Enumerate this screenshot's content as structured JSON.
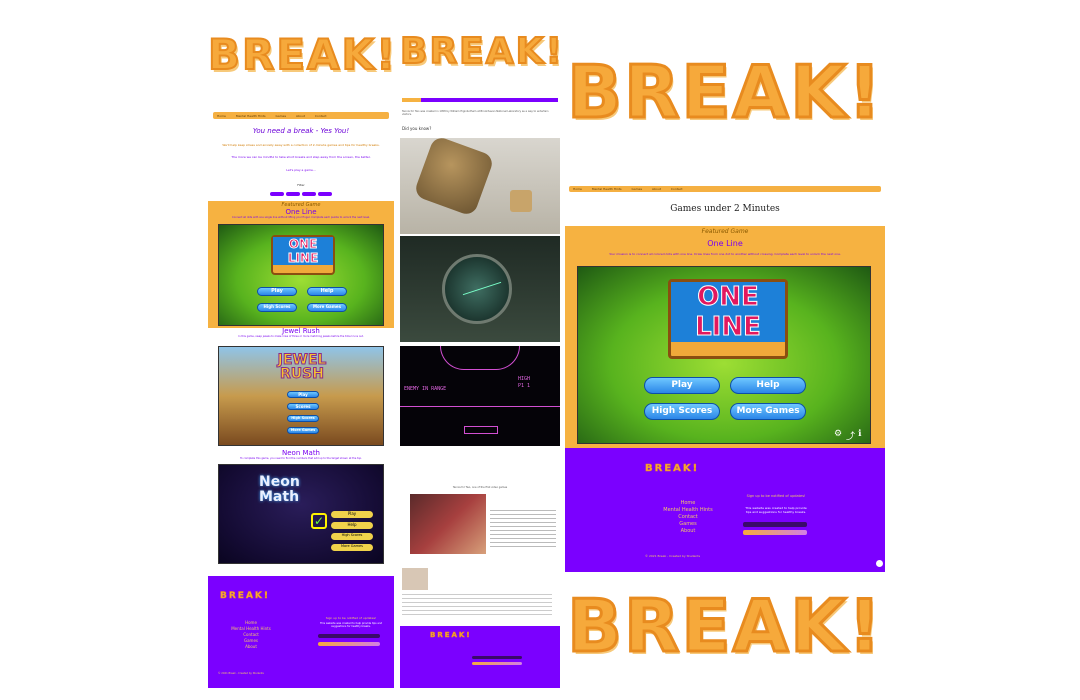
{
  "logo_text": "BREAK!",
  "nav": {
    "items": [
      "Home",
      "Mental Health Hints",
      "Games",
      "About",
      "Contact"
    ]
  },
  "left_page": {
    "heading": "You need a break - Yes You!",
    "intro1": "We'll help keep stress and anxiety away with a collection of 2-minute games and tips for healthy breaks.",
    "intro2": "The more we can be mindful to take short breaks and step away from the screen, the better.",
    "cta": "Let's play a game...",
    "filter_label": "Filter",
    "filter_tags": [
      "All",
      "Puzzle",
      "Action",
      "Math"
    ],
    "featured_label": "Featured Game",
    "games": [
      {
        "title": "One Line",
        "desc": "Connect all dots with one single line without lifting your finger. Complete each puzzle to unlock the next level."
      },
      {
        "title": "Jewel Rush",
        "desc": "In this game, swap jewels to make rows of three or more matching jewels before the timer runs out."
      },
      {
        "title": "Neon Math",
        "desc": "To complete this game, you need to find the numbers that add up to the target shown at the top."
      }
    ]
  },
  "one_line_game": {
    "logo_top": "ONE",
    "logo_bottom": "LINE",
    "buttons": [
      "Play",
      "Help",
      "High Scores",
      "More Games"
    ]
  },
  "jewel_game": {
    "logo_top": "JEWEL",
    "logo_bottom": "RUSH",
    "buttons": [
      "Play",
      "Scores",
      "High Scores",
      "More Games"
    ]
  },
  "neon_game": {
    "logo_top": "Neon",
    "logo_bottom": "Math",
    "buttons": [
      "Play",
      "Help",
      "High Scores",
      "More Games"
    ]
  },
  "footer": {
    "brand": "BREAK!",
    "links": [
      "Home",
      "Mental Health Hints",
      "Contact",
      "Games",
      "About"
    ],
    "signup_title": "Sign up to be notified of updates!",
    "signup_note": "This website was created to help provide tips and suggestions for healthy breaks.",
    "submit_label": "Submit",
    "copyright": "© 2021 Break - Created by Students"
  },
  "middle_page": {
    "did_you_know": "Did you know?",
    "caption": "Tennis for Two, one of the first video games",
    "article_text": "Tennis for Two was created in 1958 by William Higinbotham at Brookhaven National Laboratory as a way to entertain visitors.",
    "radar_text_left": "ENEMY IN RANGE",
    "radar_text_right1": "HIGH",
    "radar_text_right2": "P1 1"
  },
  "right_page": {
    "heading": "Games under 2 Minutes",
    "featured_label": "Featured Game",
    "game_title": "One Line",
    "game_desc": "Your mission is to connect all colored dots with one line. Draw lines from one dot to another without crossing. Complete each level to unlock the next one."
  },
  "colors": {
    "orange": "#f6b241",
    "purple": "#7b00ff",
    "logo_fill": "#f6a93b",
    "game_title": "#7a00f0"
  }
}
